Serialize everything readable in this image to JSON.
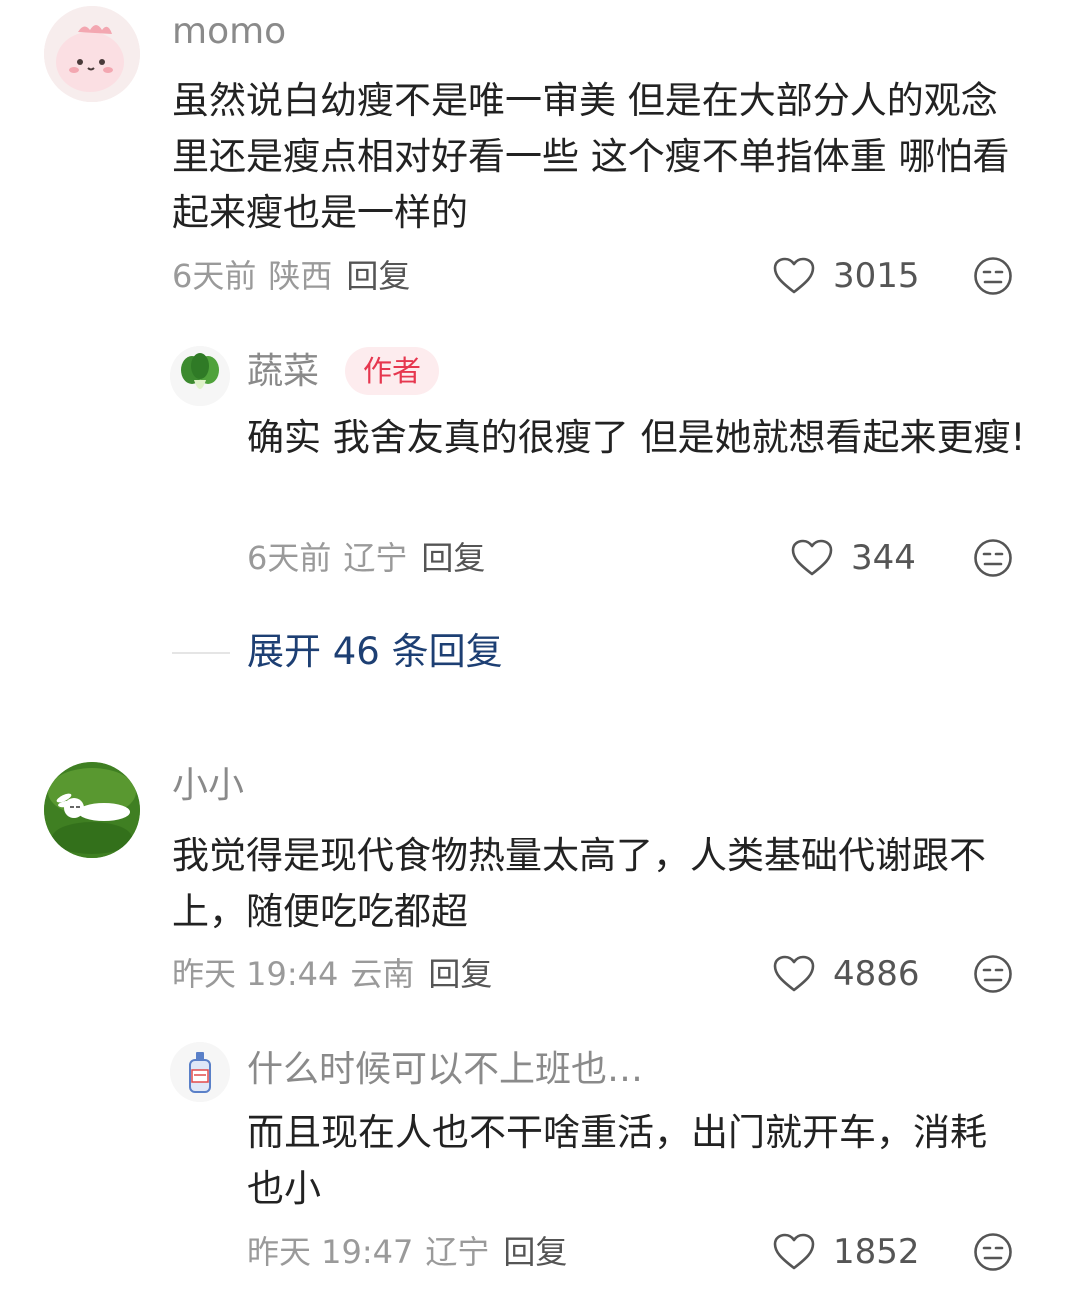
{
  "comments": [
    {
      "user": "momo",
      "text": "虽然说白幼瘦不是唯一审美 但是在大部分人的观念里还是瘦点相对好看一些 这个瘦不单指体重 哪怕看起来瘦也是一样的",
      "time": "6天前",
      "location": "陕西",
      "reply_label": "回复",
      "likes": "3015",
      "avatar_icon": "pink-creature-avatar",
      "reply": {
        "user": "蔬菜",
        "badge": "作者",
        "text": "确实 我舍友真的很瘦了 但是她就想看起来更瘦!",
        "time": "6天前",
        "location": "辽宁",
        "reply_label": "回复",
        "likes": "344",
        "avatar_icon": "bok-choy-avatar"
      },
      "expand_label": "展开 46 条回复"
    },
    {
      "user": "小小",
      "text": "我觉得是现代食物热量太高了，人类基础代谢跟不上，随便吃吃都超",
      "time": "昨天 19:44",
      "location": "云南",
      "reply_label": "回复",
      "likes": "4886",
      "avatar_icon": "rabbit-on-grass-avatar",
      "reply": {
        "user": "什么时候可以不上班也…",
        "text": "而且现在人也不干啥重活，出门就开车，消耗也小",
        "time": "昨天 19:47",
        "location": "辽宁",
        "reply_label": "回复",
        "likes": "1852",
        "avatar_icon": "bottle-avatar"
      }
    }
  ],
  "colors": {
    "author_badge_bg": "#fdecee",
    "author_badge_text": "#e6374f",
    "expand_link": "#1d3f73"
  }
}
